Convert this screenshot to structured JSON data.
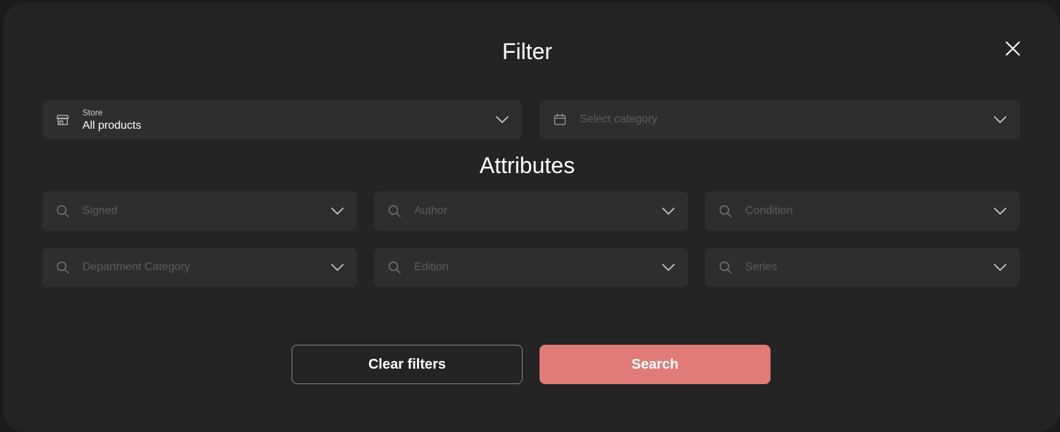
{
  "modal": {
    "title": "Filter"
  },
  "store": {
    "label": "Store",
    "value": "All products",
    "icon": "store-icon"
  },
  "category": {
    "placeholder": "Select category",
    "icon": "calendar-icon"
  },
  "attributes": {
    "title": "Attributes",
    "fields": [
      {
        "placeholder": "Signed",
        "icon": "search-icon"
      },
      {
        "placeholder": "Author",
        "icon": "search-icon"
      },
      {
        "placeholder": "Condition",
        "icon": "search-icon"
      },
      {
        "placeholder": "Department Category",
        "icon": "search-icon"
      },
      {
        "placeholder": "Edition",
        "icon": "search-icon"
      },
      {
        "placeholder": "Series",
        "icon": "search-icon"
      }
    ]
  },
  "actions": {
    "clear_label": "Clear filters",
    "search_label": "Search"
  },
  "colors": {
    "background": "#242424",
    "field": "#2e2e2e",
    "accent": "#e07b78",
    "placeholder": "#5d5d5d"
  }
}
